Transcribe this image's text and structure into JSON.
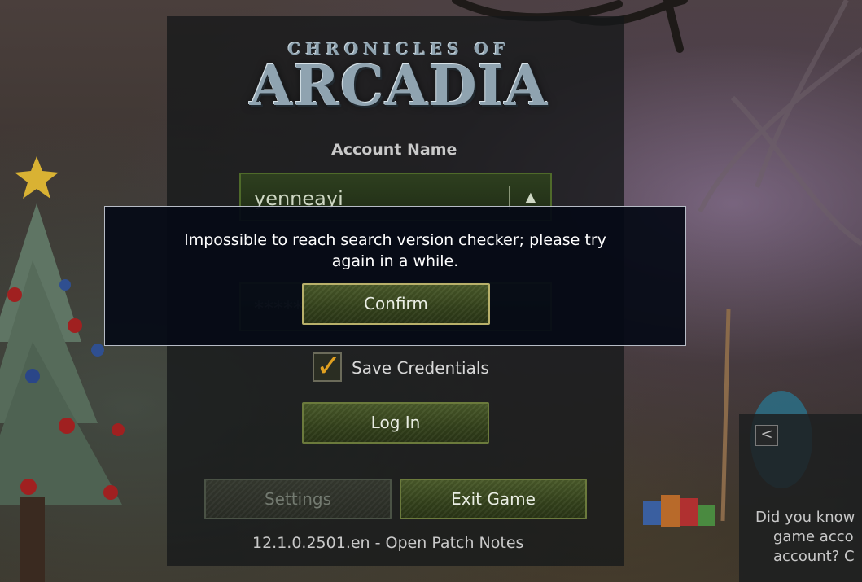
{
  "logo": {
    "top": "CHRONICLES OF",
    "main": "ARCADIA"
  },
  "login": {
    "account_label": "Account Name",
    "account_value": "yenneayi",
    "password_value": "*****",
    "save_credentials_label": "Save Credentials",
    "save_credentials_checked": true,
    "login_button": "Log In",
    "settings_button": "Settings",
    "exit_button": "Exit Game",
    "version_text": "12.1.0.2501.en - Open Patch Notes"
  },
  "dialog": {
    "message_line1": "Impossible to reach search version checker; please try",
    "message_line2": "again in a while.",
    "confirm_button": "Confirm"
  },
  "tip": {
    "prev_button": "<",
    "line1": "Did you know",
    "line2": "game acco",
    "line3": "account? C"
  },
  "colors": {
    "accent_check": "#e0a020",
    "button_green": "#34421c",
    "dialog_bg": "#050a16"
  }
}
